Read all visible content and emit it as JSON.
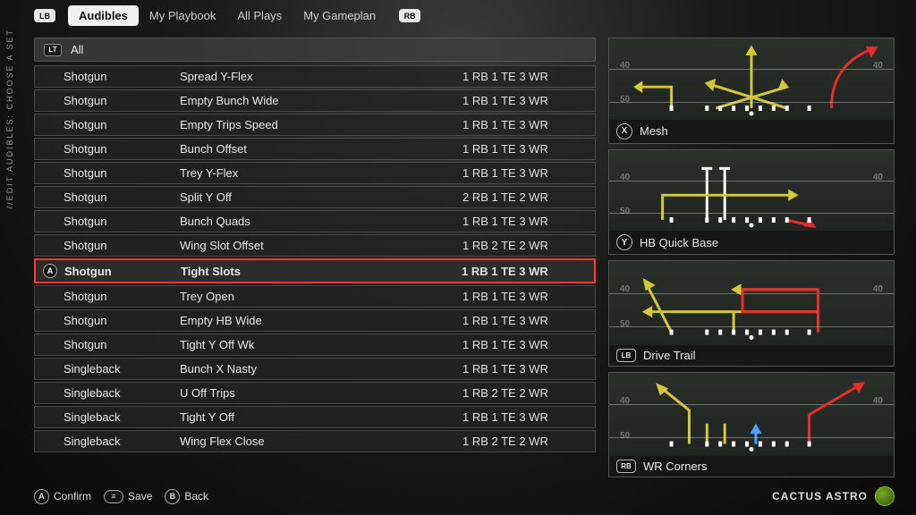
{
  "side_label": "//EDIT AUDIBLES: CHOOSE A SET",
  "bumpers": {
    "left": "LB",
    "right": "RB"
  },
  "tabs": [
    {
      "label": "Audibles",
      "active": true
    },
    {
      "label": "My Playbook",
      "active": false
    },
    {
      "label": "All Plays",
      "active": false
    },
    {
      "label": "My Gameplan",
      "active": false
    }
  ],
  "filter": {
    "badge": "LT",
    "label": "All"
  },
  "selected_index": 8,
  "selected_button": "A",
  "rows": [
    {
      "formation": "Shotgun",
      "set": "Spread Y-Flex",
      "personnel": "1 RB 1 TE 3 WR"
    },
    {
      "formation": "Shotgun",
      "set": "Empty Bunch Wide",
      "personnel": "1 RB 1 TE 3 WR"
    },
    {
      "formation": "Shotgun",
      "set": "Empty Trips Speed",
      "personnel": "1 RB 1 TE 3 WR"
    },
    {
      "formation": "Shotgun",
      "set": "Bunch Offset",
      "personnel": "1 RB 1 TE 3 WR"
    },
    {
      "formation": "Shotgun",
      "set": "Trey Y-Flex",
      "personnel": "1 RB 1 TE 3 WR"
    },
    {
      "formation": "Shotgun",
      "set": "Split Y Off",
      "personnel": "2 RB 1 TE 2 WR"
    },
    {
      "formation": "Shotgun",
      "set": "Bunch Quads",
      "personnel": "1 RB 1 TE 3 WR"
    },
    {
      "formation": "Shotgun",
      "set": "Wing Slot Offset",
      "personnel": "1 RB 2 TE 2 WR"
    },
    {
      "formation": "Shotgun",
      "set": "Tight Slots",
      "personnel": "1 RB 1 TE 3 WR"
    },
    {
      "formation": "Shotgun",
      "set": "Trey Open",
      "personnel": "1 RB 1 TE 3 WR"
    },
    {
      "formation": "Shotgun",
      "set": "Empty HB Wide",
      "personnel": "1 RB 1 TE 3 WR"
    },
    {
      "formation": "Shotgun",
      "set": "Tight Y Off Wk",
      "personnel": "1 RB 1 TE 3 WR"
    },
    {
      "formation": "Singleback",
      "set": "Bunch X Nasty",
      "personnel": "1 RB 1 TE 3 WR"
    },
    {
      "formation": "Singleback",
      "set": "U Off Trips",
      "personnel": "1 RB 2 TE 2 WR"
    },
    {
      "formation": "Singleback",
      "set": "Tight Y Off",
      "personnel": "1 RB 1 TE 3 WR"
    },
    {
      "formation": "Singleback",
      "set": "Wing Flex Close",
      "personnel": "1 RB 2 TE 2 WR"
    }
  ],
  "previews": [
    {
      "button": "X",
      "button_style": "round",
      "name": "Mesh"
    },
    {
      "button": "Y",
      "button_style": "round",
      "name": "HB Quick Base"
    },
    {
      "button": "LB",
      "button_style": "pill",
      "name": "Drive Trail"
    },
    {
      "button": "RB",
      "button_style": "pill",
      "name": "WR Corners"
    }
  ],
  "yard_markers": {
    "left": "50",
    "tl": "40",
    "tr": "40"
  },
  "footer": {
    "confirm": {
      "btn": "A",
      "label": "Confirm"
    },
    "save": {
      "btn": "≡",
      "label": "Save"
    },
    "back": {
      "btn": "B",
      "label": "Back"
    },
    "team": "CACTUS ASTRO"
  },
  "colors": {
    "route_primary": "#d4c738",
    "route_hot": "#e62d2d",
    "route_block": "#ffffff",
    "select_border": "#ff3a2a"
  }
}
